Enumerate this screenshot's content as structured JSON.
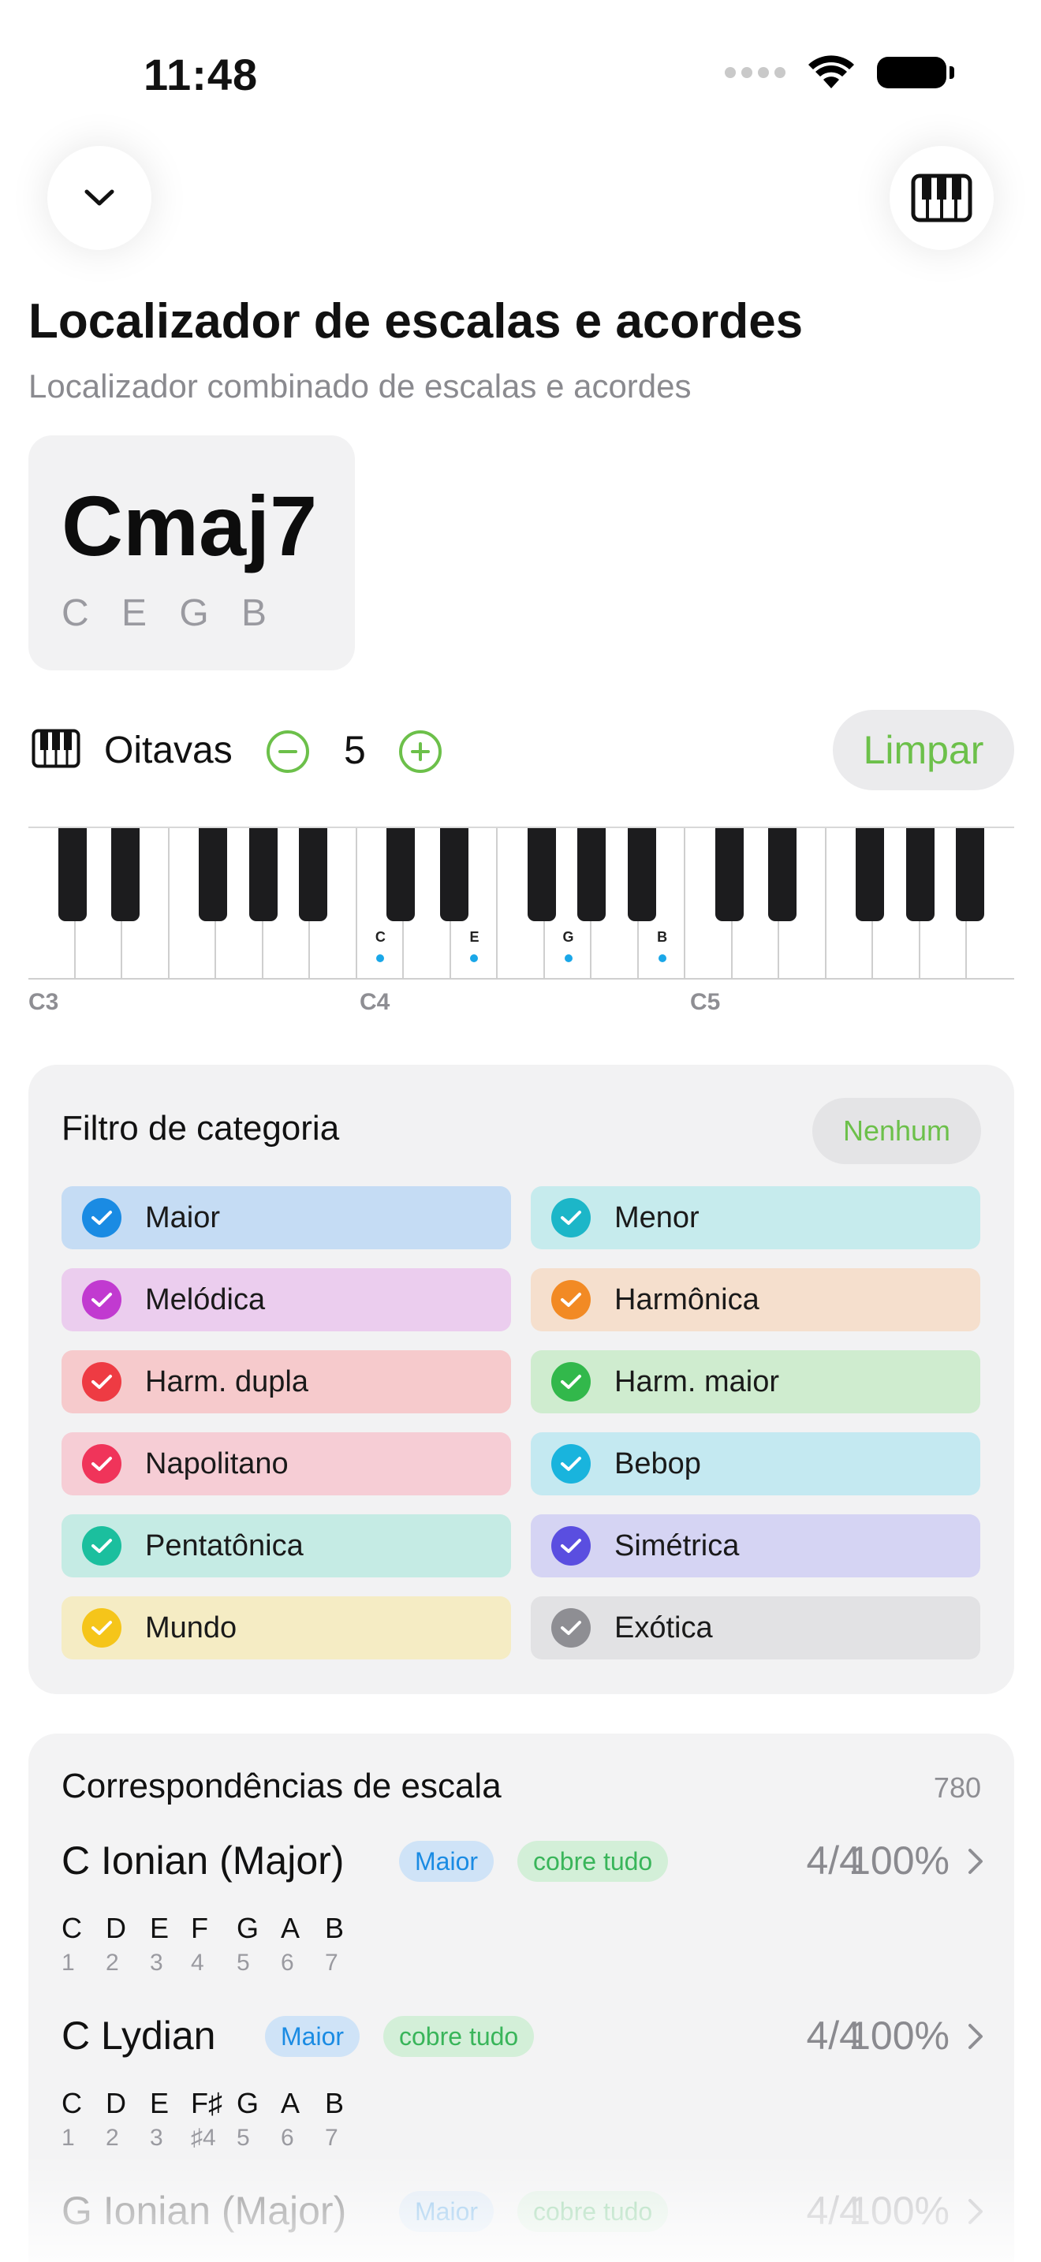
{
  "status_bar": {
    "time": "11:48"
  },
  "header": {
    "title": "Localizador de escalas e acordes",
    "subtitle": "Localizador combinado de escalas e acordes",
    "down_icon": "chevron-down-icon",
    "piano_icon": "piano-icon"
  },
  "chord": {
    "name": "Cmaj7",
    "notes": "C E G B"
  },
  "octaves": {
    "label": "Oitavas",
    "value": "5",
    "clear_label": "Limpar",
    "accent": "#6cc04a"
  },
  "keyboard": {
    "octave_labels": [
      "C3",
      "C4",
      "C5"
    ],
    "highlighted": [
      {
        "label": "C"
      },
      {
        "label": "E"
      },
      {
        "label": "G"
      },
      {
        "label": "B"
      }
    ],
    "dot_color": "#1aa7e8"
  },
  "filter": {
    "title": "Filtro de categoria",
    "none_label": "Nenhum",
    "categories": [
      {
        "label": "Maior",
        "bg": "#c5dcf4",
        "check": "#1a8be3"
      },
      {
        "label": "Menor",
        "bg": "#c6ebed",
        "check": "#1cb6c8"
      },
      {
        "label": "Melódica",
        "bg": "#ebcdee",
        "check": "#c13ad0"
      },
      {
        "label": "Harmônica",
        "bg": "#f5dfcd",
        "check": "#f28a24"
      },
      {
        "label": "Harm. dupla",
        "bg": "#f6cacc",
        "check": "#ee3b43"
      },
      {
        "label": "Harm. maior",
        "bg": "#cfeccf",
        "check": "#32b84b"
      },
      {
        "label": "Napolitano",
        "bg": "#f6cdd5",
        "check": "#f0345a"
      },
      {
        "label": "Bebop",
        "bg": "#c4e9f1",
        "check": "#19b4dd"
      },
      {
        "label": "Pentatônica",
        "bg": "#c5ebe4",
        "check": "#1bbf9e"
      },
      {
        "label": "Simétrica",
        "bg": "#d5d4f3",
        "check": "#5a4ee0"
      },
      {
        "label": "Mundo",
        "bg": "#f5ecc4",
        "check": "#f5c51a"
      },
      {
        "label": "Exótica",
        "bg": "#e2e2e4",
        "check": "#8e8e93"
      }
    ]
  },
  "matches": {
    "title": "Correspondências de escala",
    "count": "780",
    "rows": [
      {
        "name": "C Ionian (Major)",
        "category": "Maior",
        "coverage": "cobre tudo",
        "ratio": "4/4",
        "percent": "100%",
        "notes": [
          "C",
          "D",
          "E",
          "F",
          "G",
          "A",
          "B"
        ],
        "degrees": [
          "1",
          "2",
          "3",
          "4",
          "5",
          "6",
          "7"
        ]
      },
      {
        "name": "C Lydian",
        "category": "Maior",
        "coverage": "cobre tudo",
        "ratio": "4/4",
        "percent": "100%",
        "notes": [
          "C",
          "D",
          "E",
          "F♯",
          "G",
          "A",
          "B"
        ],
        "degrees": [
          "1",
          "2",
          "3",
          "♯4",
          "5",
          "6",
          "7"
        ]
      },
      {
        "name": "G Ionian (Major)",
        "category": "Maior",
        "coverage": "cobre tudo",
        "ratio": "4/4",
        "percent": "100%"
      }
    ]
  }
}
